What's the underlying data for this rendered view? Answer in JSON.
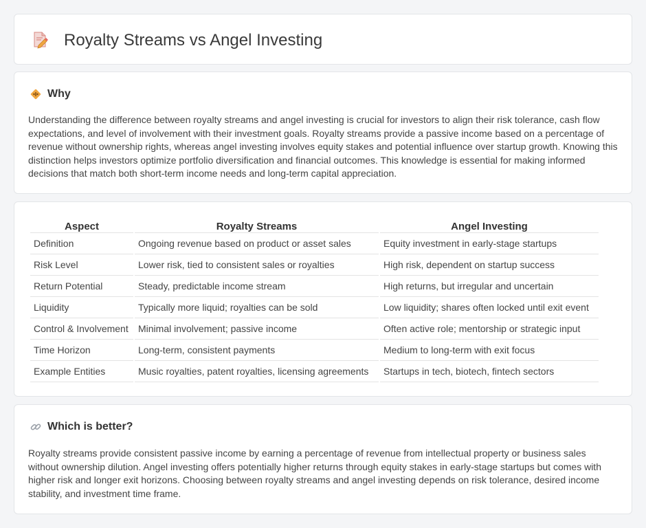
{
  "header": {
    "title": "Royalty Streams vs Angel Investing",
    "icon": "document-pencil-icon"
  },
  "why": {
    "icon": "diamond-sign-icon",
    "title": "Why",
    "text": "Understanding the difference between royalty streams and angel investing is crucial for investors to align their risk tolerance, cash flow expectations, and level of involvement with their investment goals. Royalty streams provide a passive income based on a percentage of revenue without ownership rights, whereas angel investing involves equity stakes and potential influence over startup growth. Knowing this distinction helps investors optimize portfolio diversification and financial outcomes. This knowledge is essential for making informed decisions that match both short-term income needs and long-term capital appreciation."
  },
  "comparison": {
    "headers": [
      "Aspect",
      "Royalty Streams",
      "Angel Investing"
    ],
    "rows": [
      [
        "Definition",
        "Ongoing revenue based on product or asset sales",
        "Equity investment in early-stage startups"
      ],
      [
        "Risk Level",
        "Lower risk, tied to consistent sales or royalties",
        "High risk, dependent on startup success"
      ],
      [
        "Return Potential",
        "Steady, predictable income stream",
        "High returns, but irregular and uncertain"
      ],
      [
        "Liquidity",
        "Typically more liquid; royalties can be sold",
        "Low liquidity; shares often locked until exit event"
      ],
      [
        "Control & Involvement",
        "Minimal involvement; passive income",
        "Often active role; mentorship or strategic input"
      ],
      [
        "Time Horizon",
        "Long-term, consistent payments",
        "Medium to long-term with exit focus"
      ],
      [
        "Example Entities",
        "Music royalties, patent royalties, licensing agreements",
        "Startups in tech, biotech, fintech sectors"
      ]
    ]
  },
  "better": {
    "icon": "link-icon",
    "title": "Which is better?",
    "text": "Royalty streams provide consistent passive income by earning a percentage of revenue from intellectual property or business sales without ownership dilution. Angel investing offers potentially higher returns through equity stakes in early-stage startups but comes with higher risk and longer exit horizons. Choosing between royalty streams and angel investing depends on risk tolerance, desired income stability, and investment time frame."
  },
  "colors": {
    "accent_orange": "#f0a640",
    "icon_pink": "#e8655f",
    "link_gray": "#9aa0a8"
  }
}
